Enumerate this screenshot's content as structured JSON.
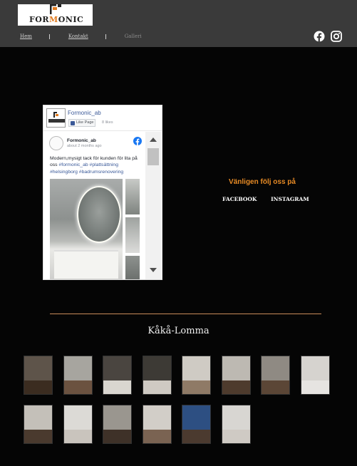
{
  "header": {
    "logo_text_before": "FOR",
    "logo_text_accent": "M",
    "logo_text_after": "ONIC",
    "nav": [
      {
        "label": "Hem"
      },
      {
        "label": "Kontakt"
      },
      {
        "label": "Galleri"
      }
    ],
    "social_icons": [
      "facebook-icon",
      "instagram-icon"
    ]
  },
  "facebook_widget": {
    "page_name": "Formonic_ab",
    "like_button": "Like Page",
    "likes": "8 likes",
    "post": {
      "author": "Formonic_ab",
      "time": "about 2 months ago",
      "text": "Modern,mysigt tack för kunden för lita på oss",
      "hashtags": "#formonic_ab #plattsättning #helsingborg #badrumsrenovering"
    }
  },
  "follow": {
    "title": "Vänligen följ oss på",
    "facebook": "FACEBOOK",
    "instagram": "INSTAGRAM"
  },
  "gallery": {
    "title": "Kåkå-Lomma",
    "images": [
      {
        "name": "gallery-photo-1",
        "wall": "#5e544a",
        "floor": "#3b2c20"
      },
      {
        "name": "gallery-photo-2",
        "wall": "#a7a59f",
        "floor": "#6b5240"
      },
      {
        "name": "gallery-photo-3",
        "wall": "#4a4540",
        "floor": "#d9d6d0"
      },
      {
        "name": "gallery-photo-4",
        "wall": "#3d3a35",
        "floor": "#cfcac3"
      },
      {
        "name": "gallery-photo-5",
        "wall": "#cfcbc4",
        "floor": "#8f7a66"
      },
      {
        "name": "gallery-photo-6",
        "wall": "#bdb9b2",
        "floor": "#4e3b2d"
      },
      {
        "name": "gallery-photo-7",
        "wall": "#8f8a83",
        "floor": "#5b4636"
      },
      {
        "name": "gallery-photo-8",
        "wall": "#d6d3cf",
        "floor": "#e6e4e1"
      },
      {
        "name": "gallery-photo-9",
        "wall": "#c4c0b9",
        "floor": "#4a3a2e"
      },
      {
        "name": "gallery-photo-10",
        "wall": "#dcdad6",
        "floor": "#c9c4bd"
      },
      {
        "name": "gallery-photo-11",
        "wall": "#9a968f",
        "floor": "#3e3128"
      },
      {
        "name": "gallery-photo-12",
        "wall": "#d2cec8",
        "floor": "#7a6352"
      },
      {
        "name": "gallery-photo-13",
        "wall": "#2d4f82",
        "floor": "#4b3a2f"
      },
      {
        "name": "gallery-photo-14",
        "wall": "#d8d6d2",
        "floor": "#cfcac4"
      }
    ]
  },
  "colors": {
    "header_bg": "#3a3a3a",
    "page_bg": "#050505",
    "accent": "#e88b25",
    "facebook_blue": "#3b5998"
  }
}
